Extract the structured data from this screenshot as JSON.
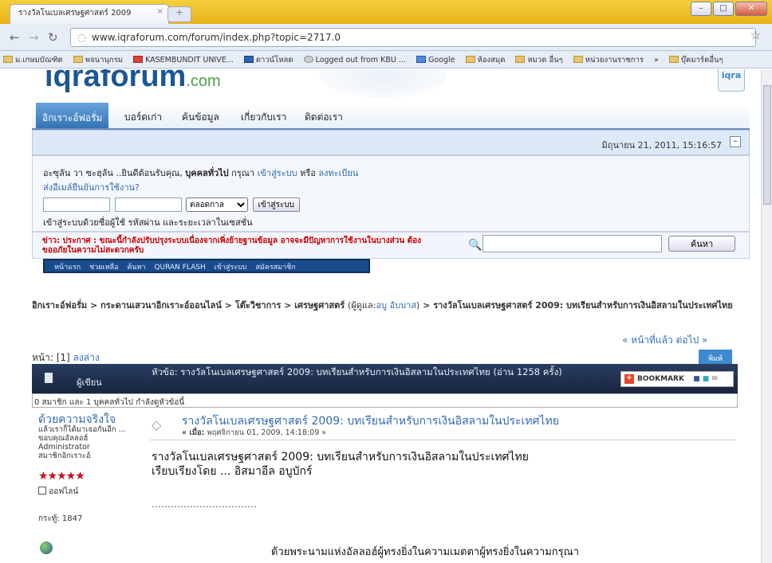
{
  "browser": {
    "tab_title": "รางวัลโนเบลเศรษฐศาสตร์ 2009",
    "tab_close": "×",
    "new_tab": "+",
    "url": "www.iqraforum.com/forum/index.php?topic=2717.0",
    "window_buttons": [
      "–",
      "□",
      "✕"
    ]
  },
  "bookmarks": [
    "ม.เกษมบัณฑิต",
    "พจนานุกรม",
    "KASEMBUNDIT UNIVE...",
    "ดาวน์โหลด",
    "Logged out from KBU ...",
    "Google",
    "ห้องสมุด",
    "หมวด อื่นๆ",
    "หน่วยงานราชการ",
    "»",
    "บุ๊คมาร์คอื่นๆ"
  ],
  "site": {
    "logo": "iqraforum",
    "logo_suffix": ".com",
    "badge": "iqra"
  },
  "menu": {
    "items": [
      "อิกเราะอ์ฟอรั่ม",
      "บอร์ดเก่า",
      "ค้นข้อมูล",
      "เกี่ยวกับเรา",
      "ติดต่อเรา"
    ]
  },
  "datebar": {
    "datetime": "มิถุนายน 21, 2011, 15:16:57",
    "collapse": "–"
  },
  "login": {
    "welcome_prefix": "อะซุลัน วา ซะฮฺลัน ..ยินดีต้อนรับคุณ,",
    "guest": "บุคคลทั่วไป",
    "please": "กรุณา",
    "login_link": "เข้าสู่ระบบ",
    "or": "หรือ",
    "register_link": "ลงทะเบียน",
    "activation_link": "ส่งอีเมล์ยืนยันการใช้งาน?",
    "duration": "ตลอดกาล",
    "login_button": "เข้าสู่ระบบ",
    "hint": "เข้าสู่ระบบด้วยชื่อผู้ใช้ รหัสผ่าน และระยะเวลาในเซสชั่น"
  },
  "news": {
    "text": "ข่าว: ประกาศ : ขณะนี้กำลังปรับปรุงระบบเนื่องจากเพิ่งย้ายฐานข้อมูล อาจจะมีปัญหาการใช้งานในบางส่วน ต้องขออภัยในความไม่สะดวกครับ",
    "search_button": "ค้นหา"
  },
  "quicklinks": [
    "หน้าแรก",
    "ช่วยเหลือ",
    "ค้นหา",
    "QURAN FLASH",
    "เข้าสู่ระบบ",
    "สมัครสมาชิก"
  ],
  "breadcrumb": {
    "items": [
      "อิกเราะอ์ฟอรั่ม",
      "กระดานเสวนาอิกเราะอ์ออนไลน์",
      "โต๊ะวิชาการ",
      "เศรษฐศาสตร์"
    ],
    "moderator_prefix": "(ผู้ดูแล:",
    "moderator": "อบู อับบาส",
    "moderator_suffix": ")",
    "current": "รางวัลโนเบลเศรษฐศาสตร์ 2009: บทเรียนสำหรับการเงินอิสลามในประเทศไทย",
    "sep": ">"
  },
  "pagination": {
    "prev_next": "« หน้าที่แล้ว ต่อไป »",
    "pages_label": "หน้า: [1]",
    "bottom_link": "ลงล่าง",
    "print": "พิมพ์"
  },
  "thread": {
    "author_label": "ผู้เขียน",
    "title": "หัวข้อ: รางวัลโนเบลเศรษฐศาสตร์ 2009: บทเรียนสำหรับการเงินอิสลามในประเทศไทย  (อ่าน 1258 ครั้ง)",
    "bookmark_label": "BOOKMARK",
    "members_viewing": "0 สมาชิก และ 1 บุคคลทั่วไป กำลังดูหัวข้อนี้"
  },
  "post": {
    "poster_name": "ด้วยความจริงใจ",
    "poster_info": [
      "แล้วเราก็ได้มาเจอกันอีก ...",
      "ขอบคุณอัลลอฮ์",
      "Administrator",
      "สมาชิกอิกเราะอ์"
    ],
    "stars": "★★★★★",
    "status": "ออฟไลน์",
    "post_count": "กระทู้: 1847",
    "subject": "รางวัลโนเบลเศรษฐศาสตร์ 2009: บทเรียนสำหรับการเงินอิสลามในประเทศไทย",
    "date_label": "« เมื่อ:",
    "date": "พฤศจิกายน 01, 2009, 14:18:09 »",
    "line1": "รางวัลโนเบลเศรษฐศาสตร์ 2009: บทเรียนสำหรับการเงินอิสลามในประเทศไทย",
    "line2": "เรียบเรียงโดย ... อิสมาอีล อบูบักร์",
    "dots": "……………………………",
    "line3": "ด้วยพระนามแห่งอัลลอฮ์ผู้ทรงยิ่งในความเมตตาผู้ทรงยิ่งในความกรุณา"
  }
}
